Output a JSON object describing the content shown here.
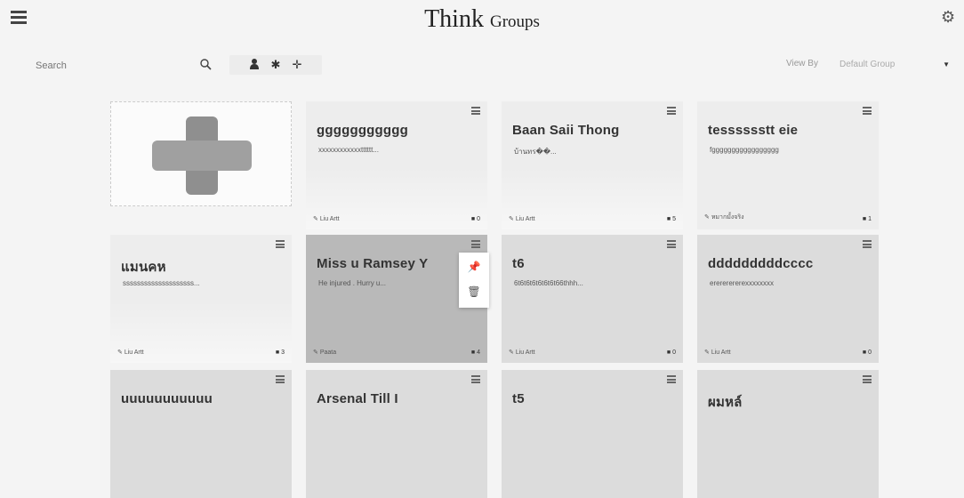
{
  "header": {
    "title_main": "Think",
    "title_sub": "Groups"
  },
  "toolbar": {
    "search_placeholder": "Search",
    "filter_icons": [
      "user-icon",
      "asterisk-icon",
      "move-icon"
    ],
    "view_by_label": "View By",
    "group_selected": "Default Group"
  },
  "cards": [
    {
      "title": "ggggggggggg",
      "desc": "xxxxxxxxxxxxtttttt...",
      "author": "Liu Artt",
      "comments": "0"
    },
    {
      "title": "Baan Saii Thong",
      "desc": "บ้านทร��...",
      "author": "Liu Artt",
      "comments": "5"
    },
    {
      "title": "tesssssstt eie",
      "desc": "fggggggggggggggggg",
      "author": "หมากมั้งจริง",
      "comments": "1"
    },
    {
      "title": "แมนคห",
      "desc": "ssssssssssssssssssss...",
      "author": "Liu Artt",
      "comments": "3"
    },
    {
      "title": "Miss u Ramsey Y",
      "desc": "He injured . Hurry u...",
      "author": "Paata",
      "comments": "4"
    },
    {
      "title": "t6",
      "desc": "6t6t6t6t6t6t6t66thhh...",
      "author": "Liu Artt",
      "comments": "0"
    },
    {
      "title": "dddddddddcccc",
      "desc": "erererererexxxxxxxx",
      "author": "Liu Artt",
      "comments": "0"
    },
    {
      "title": "uuuuuuuuuuu"
    },
    {
      "title": "Arsenal Till I"
    },
    {
      "title": "t5"
    },
    {
      "title": "ผมหล์"
    }
  ],
  "colors": {
    "card_light": "#ededed",
    "card_mid": "#dcdcdc",
    "card_dark": "#b9b9b9"
  }
}
